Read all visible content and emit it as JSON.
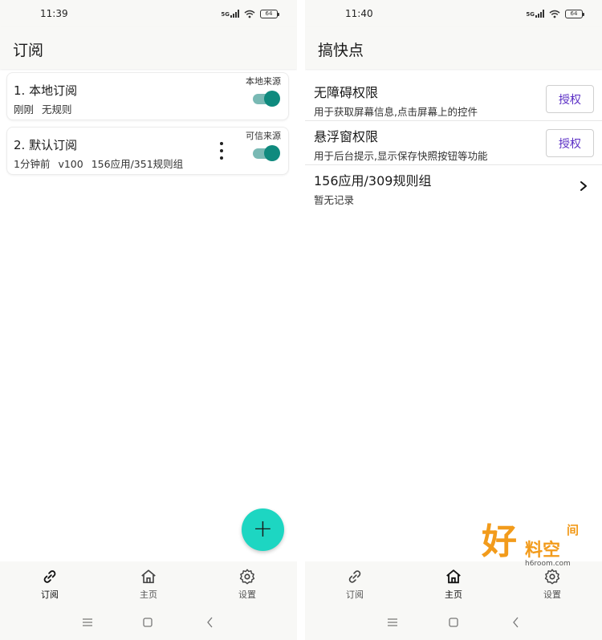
{
  "left": {
    "status": {
      "time": "11:39",
      "signal": "5G",
      "battery": "64"
    },
    "appbar": {
      "title": "订阅"
    },
    "subscriptions": [
      {
        "name": "1. 本地订阅",
        "meta": [
          "刚刚",
          "无规则"
        ],
        "tag": "本地来源",
        "enabled": true
      },
      {
        "name": "2. 默认订阅",
        "meta": [
          "1分钟前",
          "v100",
          "156应用/351规则组"
        ],
        "tag": "可信来源",
        "enabled": true
      }
    ],
    "fab": {
      "label": "+"
    },
    "nav": [
      {
        "label": "订阅",
        "icon": "link-icon",
        "active": true
      },
      {
        "label": "主页",
        "icon": "home-icon",
        "active": false
      },
      {
        "label": "设置",
        "icon": "gear-icon",
        "active": false
      }
    ]
  },
  "right": {
    "status": {
      "time": "11:40",
      "signal": "5G",
      "battery": "64"
    },
    "appbar": {
      "title": "搞快点"
    },
    "rows": [
      {
        "title": "无障碍权限",
        "desc": "用于获取屏幕信息,点击屏幕上的控件",
        "button": "授权"
      },
      {
        "title": "悬浮窗权限",
        "desc": "用于后台提示,显示保存快照按钮等功能",
        "button": "授权"
      },
      {
        "title": "156应用/309规则组",
        "desc": "暂无记录"
      }
    ],
    "nav": [
      {
        "label": "订阅",
        "icon": "link-icon",
        "active": false
      },
      {
        "label": "主页",
        "icon": "home-icon",
        "active": true
      },
      {
        "label": "设置",
        "icon": "gear-icon",
        "active": false
      }
    ]
  },
  "watermark": {
    "big": "好",
    "small": "料空",
    "corner": "间",
    "url": "h6room.com"
  },
  "colors": {
    "accent": "#0f8a7e",
    "fab": "#1dd6c2",
    "grant_text": "#5b2fc5"
  }
}
